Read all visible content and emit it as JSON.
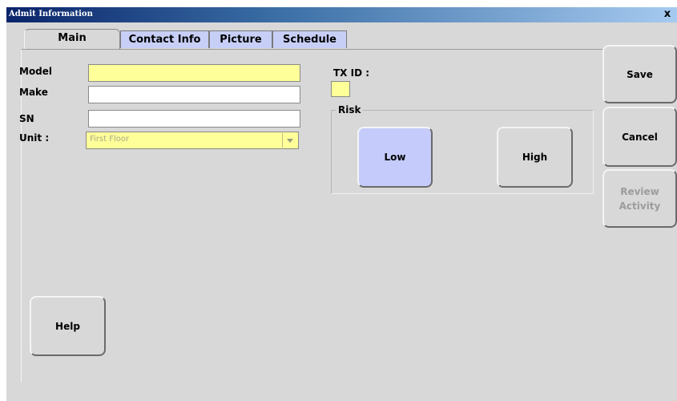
{
  "window": {
    "title": "Admit Information",
    "close_label": "x"
  },
  "tabs": [
    {
      "label": "Main",
      "active": true
    },
    {
      "label": "Contact Info",
      "active": false
    },
    {
      "label": "Picture",
      "active": false
    },
    {
      "label": "Schedule",
      "active": false
    }
  ],
  "form": {
    "model": {
      "label": "Model",
      "value": ""
    },
    "make": {
      "label": "Make",
      "value": ""
    },
    "sn": {
      "label": "SN",
      "value": ""
    },
    "unit": {
      "label": "Unit :",
      "value": "First Floor"
    },
    "tx_id": {
      "label": "TX ID :",
      "value": ""
    }
  },
  "risk": {
    "label": "Risk",
    "options": [
      "Low",
      "High"
    ],
    "selected": "Low"
  },
  "actions": {
    "save": "Save",
    "cancel": "Cancel",
    "review_activity": "Review Activity",
    "help": "Help"
  },
  "colors": {
    "required_field": "#ffff99",
    "inactive_tab": "#c7cff7",
    "selected_option": "#c5cbfb",
    "titlebar": "#0a246a"
  }
}
